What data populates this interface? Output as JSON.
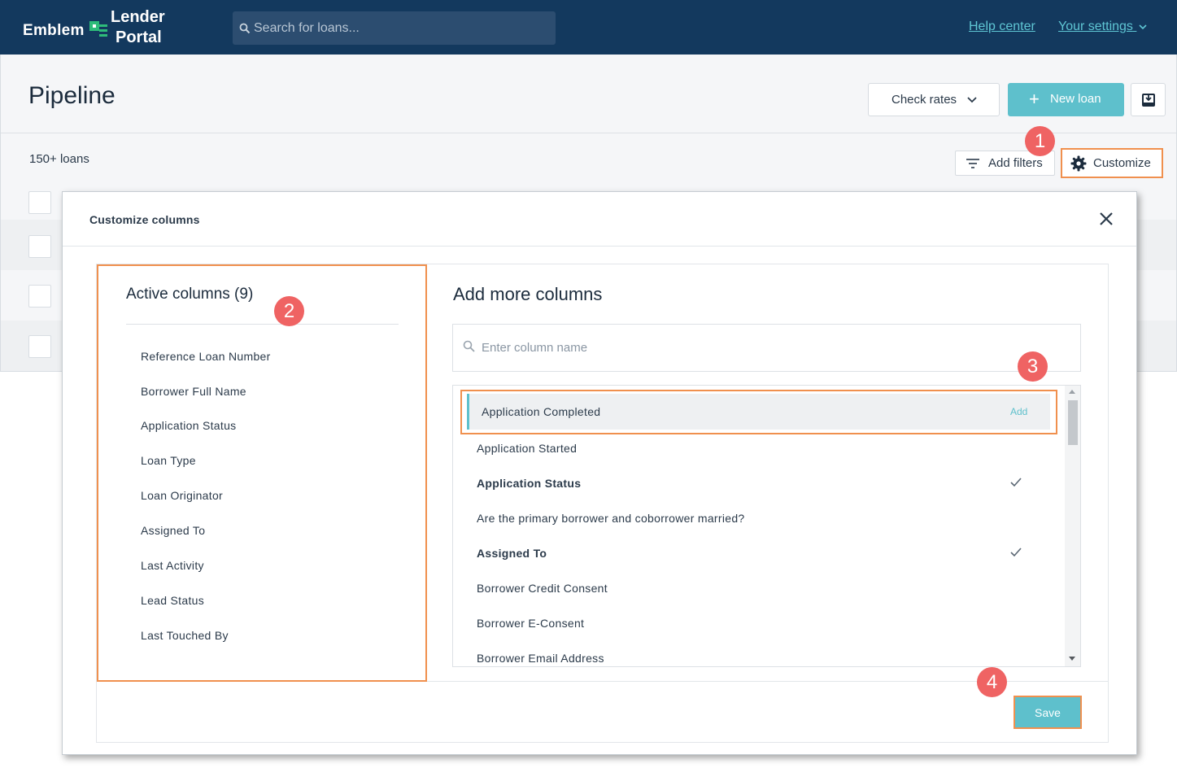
{
  "brand": {
    "name": "Emblem",
    "product_line1": "Lender",
    "product_line2": "Portal"
  },
  "search": {
    "placeholder": "Search for loans..."
  },
  "top_links": {
    "help": "Help center",
    "settings": "Your settings"
  },
  "page": {
    "title": "Pipeline",
    "check_rates": "Check rates",
    "new_loan": "New loan",
    "loan_count": "150+ loans",
    "add_filters": "Add filters",
    "customize": "Customize"
  },
  "markers": [
    "1",
    "2",
    "3",
    "4"
  ],
  "modal": {
    "title": "Customize columns",
    "active_title": "Active columns (9)",
    "active_columns": [
      "Reference Loan Number",
      "Borrower Full Name",
      "Application Status",
      "Loan Type",
      "Loan Originator",
      "Assigned To",
      "Last Activity",
      "Lead Status",
      "Last Touched By"
    ],
    "add_title": "Add more columns",
    "column_search_placeholder": "Enter column name",
    "highlighted": {
      "label": "Application Completed",
      "action": "Add"
    },
    "available_columns": [
      {
        "label": "Application Started",
        "active": false
      },
      {
        "label": "Application Status",
        "active": true
      },
      {
        "label": "Are the primary borrower and coborrower married?",
        "active": false
      },
      {
        "label": "Assigned To",
        "active": true
      },
      {
        "label": "Borrower Credit Consent",
        "active": false
      },
      {
        "label": "Borrower E-Consent",
        "active": false
      },
      {
        "label": "Borrower Email Address",
        "active": false
      }
    ],
    "save": "Save"
  },
  "colors": {
    "header_bg": "#13395e",
    "accent": "#5ec0cc",
    "annotation": "#f0904e",
    "marker": "#ef6363"
  }
}
